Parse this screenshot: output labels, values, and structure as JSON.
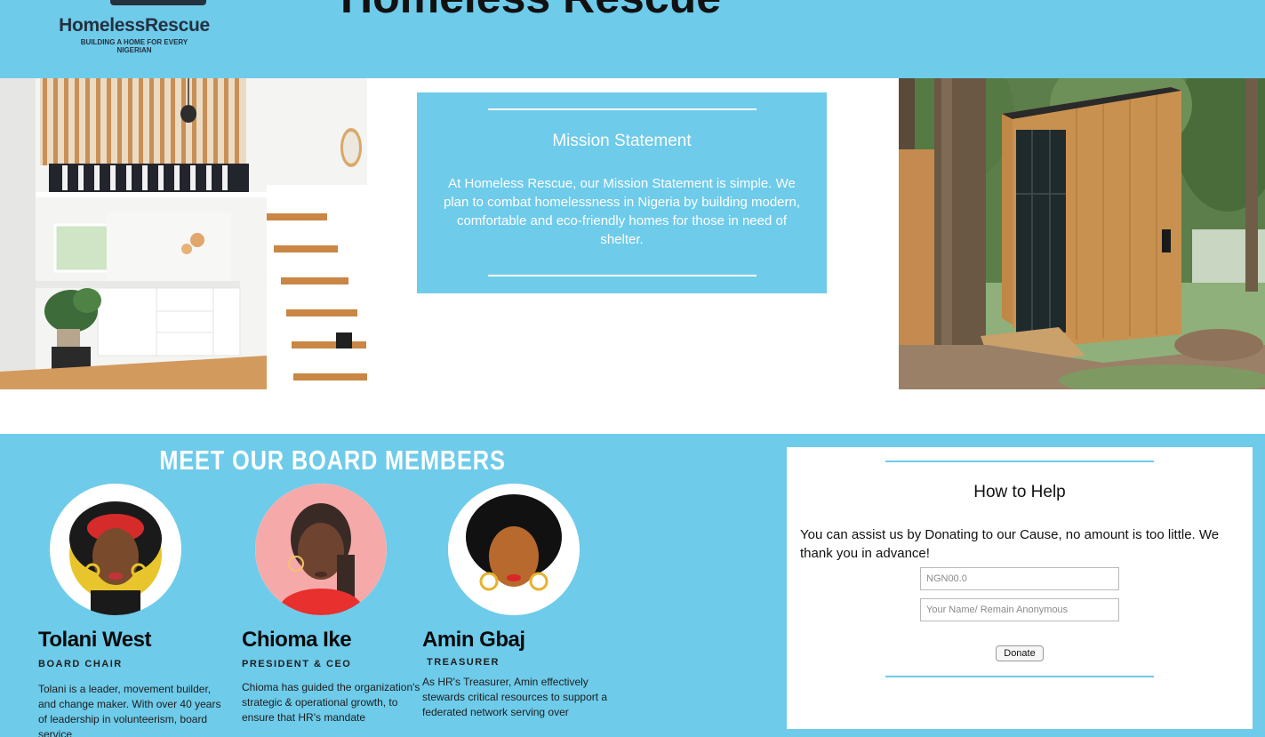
{
  "header": {
    "logo_name": "HomelessRescue",
    "logo_tagline": "BUILDING A HOME FOR EVERY NIGERIAN",
    "site_title": "Homeless Rescue"
  },
  "mission": {
    "heading": "Mission Statement",
    "body": "At Homeless Rescue, our Mission Statement is simple. We plan to combat homelessness in Nigeria by building modern, comfortable and eco-friendly homes for those in need of shelter."
  },
  "board": {
    "heading": "MEET OUR BOARD MEMBERS",
    "members": [
      {
        "name": "Tolani West",
        "role": "BOARD CHAIR",
        "bio": "Tolani is a leader, movement builder, and change maker. With over 40 years of leadership in volunteerism, board service"
      },
      {
        "name": "Chioma Ike",
        "role": "PRESIDENT & CEO",
        "bio": "Chioma has guided the organization's strategic & operational growth, to ensure that HR's mandate"
      },
      {
        "name": "Amin Gbaj",
        "role": "TREASURER",
        "bio": "As HR's Treasurer, Amin effectively stewards critical resources to support a federated network serving over"
      }
    ]
  },
  "help": {
    "heading": "How to Help",
    "body": "You can assist us by Donating to our Cause, no amount is too little. We thank you in advance!",
    "amount_placeholder": "NGN00.0",
    "name_placeholder": "Your Name/ Remain Anonymous",
    "donate_label": "Donate"
  },
  "colors": {
    "accent": "#6ecbea",
    "logo_text": "#24313f"
  }
}
